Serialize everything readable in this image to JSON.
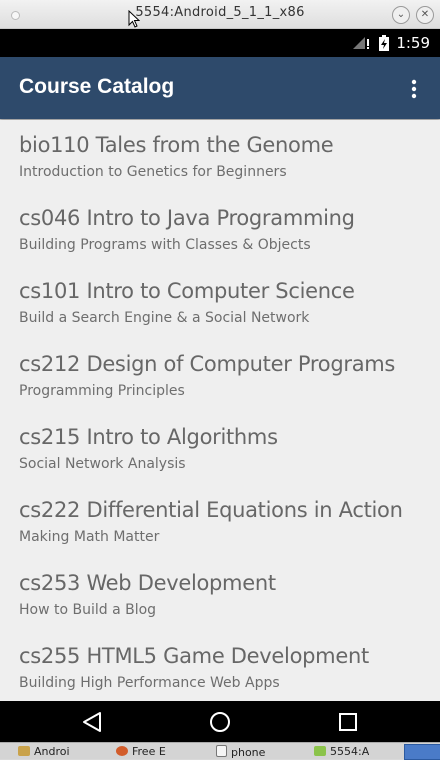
{
  "window": {
    "title": "5554:Android_5_1_1_x86",
    "minimize_glyph": "⌄",
    "close_glyph": "✕"
  },
  "statusbar": {
    "time": "1:59"
  },
  "appbar": {
    "title": "Course Catalog",
    "overflow_icon": "more-vert-icon"
  },
  "courses": [
    {
      "title": "bio110 Tales from the Genome",
      "subtitle": "Introduction to Genetics for Beginners"
    },
    {
      "title": "cs046 Intro to Java Programming",
      "subtitle": "Building Programs with Classes & Objects"
    },
    {
      "title": "cs101 Intro to Computer Science",
      "subtitle": "Build a Search Engine & a Social Network"
    },
    {
      "title": "cs212 Design of Computer Programs",
      "subtitle": "Programming Principles"
    },
    {
      "title": "cs215 Intro to Algorithms",
      "subtitle": "Social Network Analysis"
    },
    {
      "title": "cs222 Differential Equations in Action",
      "subtitle": "Making Math Matter"
    },
    {
      "title": "cs253 Web Development",
      "subtitle": "How to Build a Blog"
    },
    {
      "title": "cs255 HTML5 Game Development",
      "subtitle": "Building High Performance Web Apps"
    }
  ],
  "taskbar": {
    "items": [
      "Androi",
      "Free E",
      "phone",
      "5554:A"
    ]
  },
  "colors": {
    "appbar": "#2e4a6b",
    "list_background": "#efefef",
    "title_text": "#676767"
  }
}
